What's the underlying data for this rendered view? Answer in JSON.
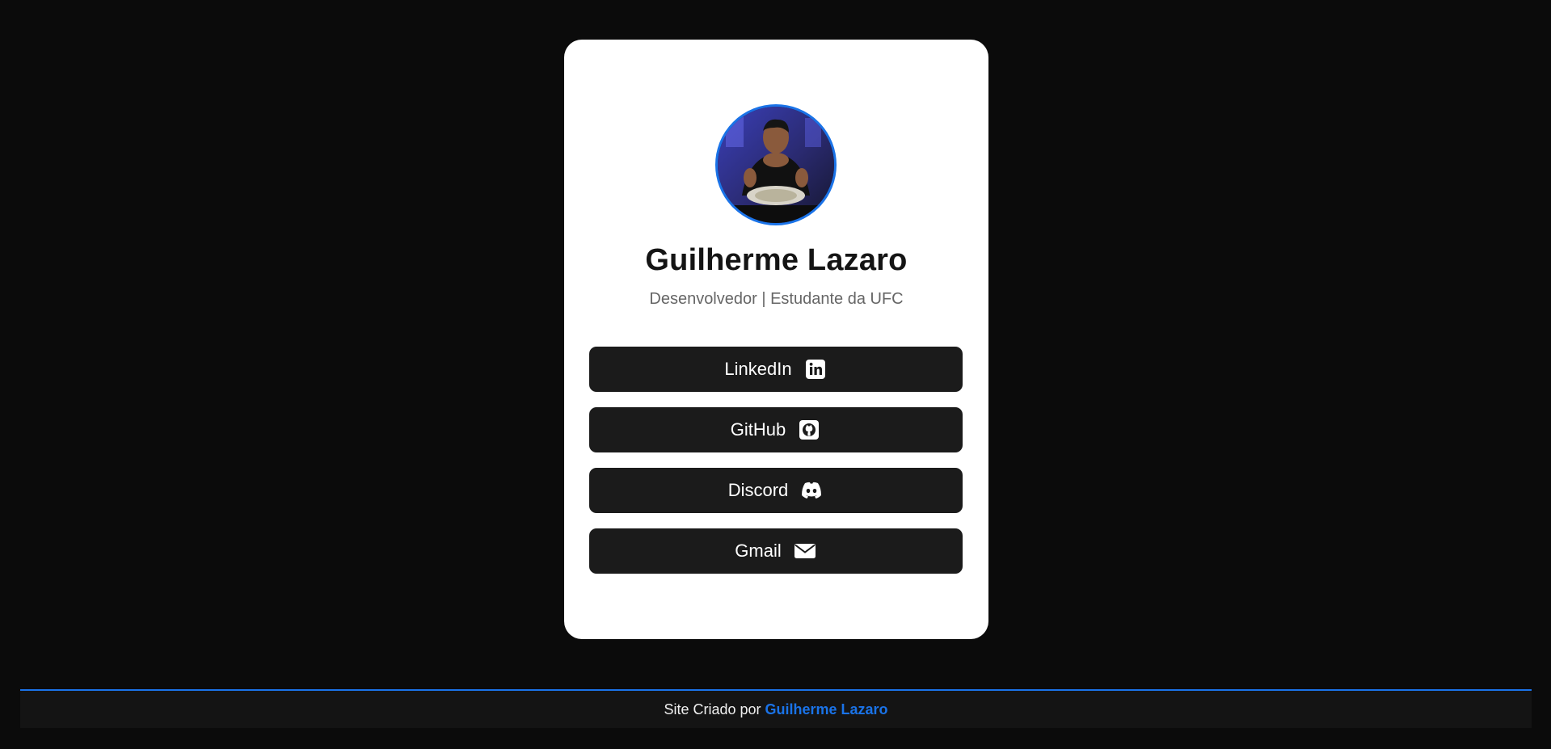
{
  "profile": {
    "name": "Guilherme Lazaro",
    "subtitle": "Desenvolvedor | Estudante da UFC"
  },
  "links": [
    {
      "label": "LinkedIn",
      "icon": "linkedin-icon"
    },
    {
      "label": "GitHub",
      "icon": "github-icon"
    },
    {
      "label": "Discord",
      "icon": "discord-icon"
    },
    {
      "label": "Gmail",
      "icon": "mail-icon"
    }
  ],
  "footer": {
    "prefix": "Site Criado por",
    "author": "Guilherme Lazaro"
  },
  "colors": {
    "background": "#0b0b0b",
    "card": "#ffffff",
    "button": "#1b1b1b",
    "accent": "#1a73e8"
  }
}
